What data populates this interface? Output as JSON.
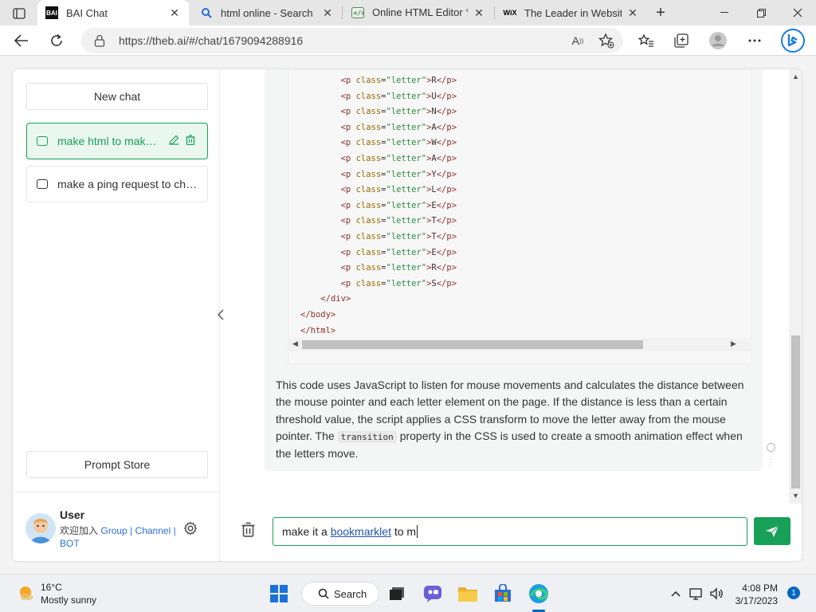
{
  "browser": {
    "tabs": [
      {
        "title": "BAI Chat",
        "favicon": "BAI"
      },
      {
        "title": "html online - Search"
      },
      {
        "title": "Online HTML Editor ✎ I"
      },
      {
        "title": "The Leader in Website C",
        "favicon": "WiX"
      }
    ],
    "new_tab": "+",
    "url": "https://theb.ai/#/chat/1679094288916"
  },
  "sidebar": {
    "new_chat_label": "New chat",
    "chats": [
      {
        "title": "make html to make the letters"
      },
      {
        "title": "make a ping request to check"
      }
    ],
    "prompt_store_label": "Prompt Store",
    "user": {
      "name": "User",
      "join_text": "欢迎加入",
      "links": [
        "Group",
        "Channel",
        "BOT"
      ],
      "separator": "|"
    }
  },
  "message": {
    "code_lines": [
      {
        "indent": "        ",
        "letter": "R"
      },
      {
        "indent": "        ",
        "letter": "U"
      },
      {
        "indent": "        ",
        "letter": "N"
      },
      {
        "indent": "        ",
        "letter": "A"
      },
      {
        "indent": "        ",
        "letter": "W"
      },
      {
        "indent": "        ",
        "letter": "A"
      },
      {
        "indent": "        ",
        "letter": "Y"
      },
      {
        "indent": "        ",
        "letter": "L"
      },
      {
        "indent": "        ",
        "letter": "E"
      },
      {
        "indent": "        ",
        "letter": "T"
      },
      {
        "indent": "        ",
        "letter": "T"
      },
      {
        "indent": "        ",
        "letter": "E"
      },
      {
        "indent": "        ",
        "letter": "R"
      },
      {
        "indent": "        ",
        "letter": "S"
      }
    ],
    "code_tail": [
      "    </div>",
      "</body>",
      "</html>"
    ],
    "paragraph_a": "This code uses JavaScript to listen for mouse movements and calculates the distance between the mouse pointer and each letter element on the page. If the distance is less than a certain threshold value, the script applies a CSS transform to move the letter away from the mouse pointer. The ",
    "paragraph_code": "transition",
    "paragraph_b": " property in the CSS is used to create a smooth animation effect when the letters move."
  },
  "input": {
    "text_before": "make it a ",
    "text_link": "bookmarklet",
    "text_after": " to m"
  },
  "taskbar": {
    "weather_temp": "16°C",
    "weather_desc": "Mostly sunny",
    "search_label": "Search",
    "time": "4:08 PM",
    "date": "3/17/2023",
    "notifications": "1"
  },
  "colors": {
    "accent": "#18a058",
    "link": "#2d6fd6"
  }
}
